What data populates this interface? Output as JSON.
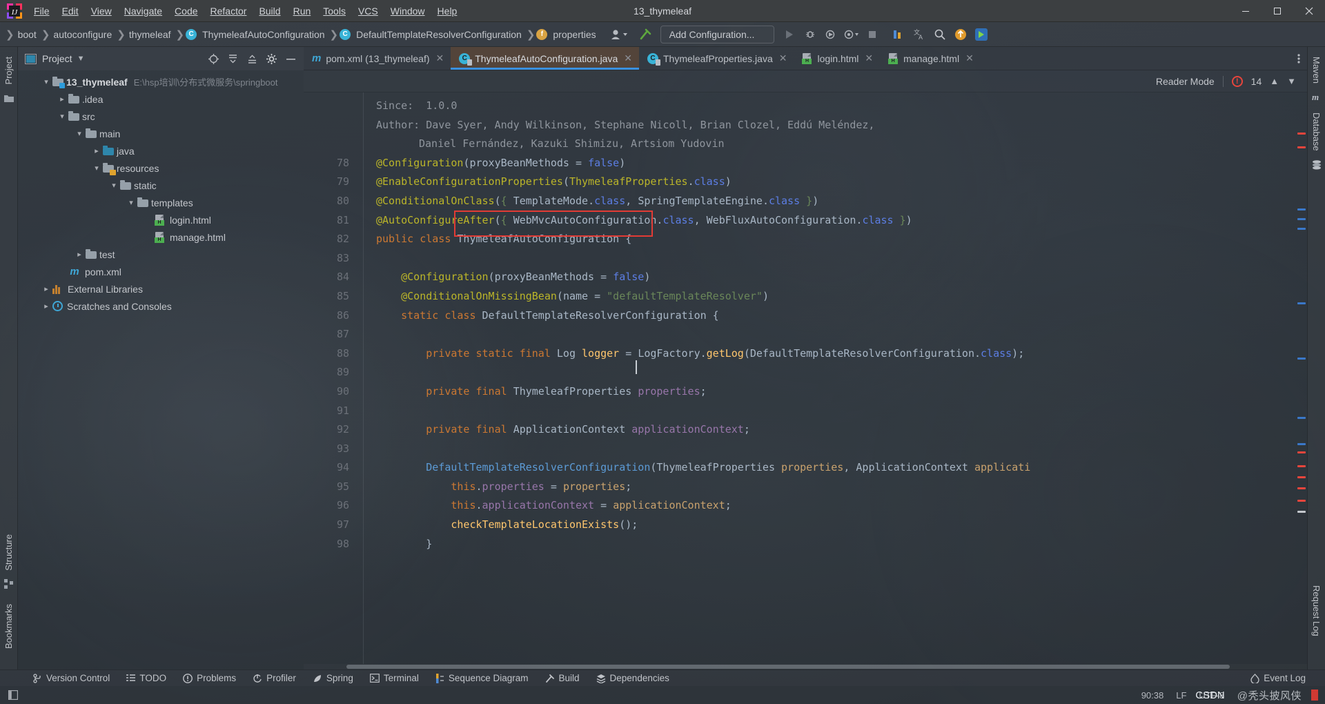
{
  "window": {
    "title": "13_thymeleaf",
    "controls": {
      "minimize": "minimize-icon",
      "maximize": "maximize-icon",
      "close": "close-icon"
    }
  },
  "menu": [
    {
      "label": "File",
      "mnemonic": "F"
    },
    {
      "label": "Edit",
      "mnemonic": "E"
    },
    {
      "label": "View",
      "mnemonic": "V"
    },
    {
      "label": "Navigate",
      "mnemonic": "N"
    },
    {
      "label": "Code",
      "mnemonic": "C"
    },
    {
      "label": "Refactor",
      "mnemonic": "R"
    },
    {
      "label": "Build",
      "mnemonic": "B"
    },
    {
      "label": "Run",
      "mnemonic": "u"
    },
    {
      "label": "Tools",
      "mnemonic": "T"
    },
    {
      "label": "VCS",
      "mnemonic": ""
    },
    {
      "label": "Window",
      "mnemonic": "W"
    },
    {
      "label": "Help",
      "mnemonic": "H"
    }
  ],
  "breadcrumb": [
    {
      "label": "boot",
      "icon": ""
    },
    {
      "label": "autoconfigure",
      "icon": ""
    },
    {
      "label": "thymeleaf",
      "icon": ""
    },
    {
      "label": "ThymeleafAutoConfiguration",
      "icon": "class-icon",
      "badge": "C"
    },
    {
      "label": "DefaultTemplateResolverConfiguration",
      "icon": "class-icon",
      "badge": "C"
    },
    {
      "label": "properties",
      "icon": "field-icon",
      "badge": "f"
    }
  ],
  "toolbar": {
    "add_configuration": "Add Configuration...",
    "buttons": [
      "user-icon",
      "hammer-build-icon",
      "run-icon",
      "debug-icon",
      "run-with-coverage-icon",
      "profile-icon",
      "stop-icon",
      "search-everywhere-icon",
      "translate-icon",
      "update-icon",
      "ide-icon"
    ]
  },
  "left_stripe": [
    {
      "label": "Project",
      "name": "tool-window-project"
    },
    {
      "label": "Structure",
      "name": "tool-window-structure"
    },
    {
      "label": "Bookmarks",
      "name": "tool-window-bookmarks"
    }
  ],
  "right_stripe": [
    {
      "label": "Maven",
      "name": "tool-window-maven"
    },
    {
      "label": "Database",
      "name": "tool-window-database"
    },
    {
      "label": "Request Log",
      "name": "tool-window-request-log"
    }
  ],
  "project": {
    "title": "Project",
    "actions": [
      "locate-icon",
      "expand-all-icon",
      "collapse-all-icon",
      "settings-icon",
      "hide-icon"
    ],
    "tree": [
      {
        "label": "13_thymeleaf",
        "path": "E:\\hsp培训\\分布式微服务\\springboot",
        "indent": 0,
        "arrow": "down",
        "icon": "module-folder",
        "bold": true
      },
      {
        "label": ".idea",
        "path": "",
        "indent": 1,
        "arrow": "right",
        "icon": "folder"
      },
      {
        "label": "src",
        "path": "",
        "indent": 1,
        "arrow": "down",
        "icon": "folder"
      },
      {
        "label": "main",
        "path": "",
        "indent": 2,
        "arrow": "down",
        "icon": "folder"
      },
      {
        "label": "java",
        "path": "",
        "indent": 3,
        "arrow": "right",
        "icon": "source-folder"
      },
      {
        "label": "resources",
        "path": "",
        "indent": 3,
        "arrow": "down",
        "icon": "resources-folder"
      },
      {
        "label": "static",
        "path": "",
        "indent": 4,
        "arrow": "down",
        "icon": "folder"
      },
      {
        "label": "templates",
        "path": "",
        "indent": 5,
        "arrow": "down",
        "icon": "folder"
      },
      {
        "label": "login.html",
        "path": "",
        "indent": 6,
        "arrow": "none",
        "icon": "html-file"
      },
      {
        "label": "manage.html",
        "path": "",
        "indent": 6,
        "arrow": "none",
        "icon": "html-file"
      },
      {
        "label": "test",
        "path": "",
        "indent": 2,
        "arrow": "right",
        "icon": "folder"
      },
      {
        "label": "pom.xml",
        "path": "",
        "indent": 1,
        "arrow": "none",
        "icon": "maven-file"
      },
      {
        "label": "External Libraries",
        "path": "",
        "indent": 0,
        "arrow": "right",
        "icon": "library-icon"
      },
      {
        "label": "Scratches and Consoles",
        "path": "",
        "indent": 0,
        "arrow": "right",
        "icon": "scratches-icon"
      }
    ]
  },
  "editor": {
    "tabs": [
      {
        "label": "pom.xml (13_thymeleaf)",
        "icon": "maven-icon",
        "active": false
      },
      {
        "label": "ThymeleafAutoConfiguration.java",
        "icon": "java-class-icon",
        "active": true
      },
      {
        "label": "ThymeleafProperties.java",
        "icon": "java-class-icon",
        "active": false
      },
      {
        "label": "login.html",
        "icon": "html-icon",
        "active": false
      },
      {
        "label": "manage.html",
        "icon": "html-icon",
        "active": false
      }
    ],
    "more_tabs": "more-tabs-icon",
    "reader_mode": "Reader Mode",
    "problem_count": "14",
    "doc_header": [
      "Since:  1.0.0",
      "Author: Dave Syer, Andy Wilkinson, Stephane Nicoll, Brian Clozel, Eddú Meléndez,",
      "Daniel Fernández, Kazuki Shimizu, Artsiom Yudovin"
    ],
    "first_line_number": 78,
    "lines": [
      {
        "n": "78",
        "fold": "minus",
        "text": "@Configuration(proxyBeanMethods = false)"
      },
      {
        "n": "79",
        "fold": "",
        "text": "@EnableConfigurationProperties(ThymeleafProperties.class)"
      },
      {
        "n": "80",
        "fold": "",
        "text": "@ConditionalOnClass({ TemplateMode.class, SpringTemplateEngine.class })"
      },
      {
        "n": "81",
        "fold": "minus",
        "text": "@AutoConfigureAfter({ WebMvcAutoConfiguration.class, WebFluxAutoConfiguration.class })"
      },
      {
        "n": "82",
        "fold": "",
        "text": "public class ThymeleafAutoConfiguration {"
      },
      {
        "n": "83",
        "fold": "",
        "text": ""
      },
      {
        "n": "84",
        "fold": "minus",
        "text": "    @Configuration(proxyBeanMethods = false)"
      },
      {
        "n": "85",
        "fold": "minus",
        "text": "    @ConditionalOnMissingBean(name = \"defaultTemplateResolver\")"
      },
      {
        "n": "86",
        "fold": "minus",
        "text": "    static class DefaultTemplateResolverConfiguration {"
      },
      {
        "n": "87",
        "fold": "",
        "text": ""
      },
      {
        "n": "88",
        "fold": "",
        "text": "        private static final Log logger = LogFactory.getLog(DefaultTemplateResolverConfiguration.class);"
      },
      {
        "n": "89",
        "fold": "",
        "text": ""
      },
      {
        "n": "90",
        "fold": "",
        "text": "        private final ThymeleafProperties properties;"
      },
      {
        "n": "91",
        "fold": "",
        "text": ""
      },
      {
        "n": "92",
        "fold": "",
        "text": "        private final ApplicationContext applicationContext;"
      },
      {
        "n": "93",
        "fold": "",
        "text": ""
      },
      {
        "n": "94",
        "fold": "minus",
        "text": "        DefaultTemplateResolverConfiguration(ThymeleafProperties properties, ApplicationContext applicati"
      },
      {
        "n": "95",
        "fold": "",
        "text": "            this.properties = properties;"
      },
      {
        "n": "96",
        "fold": "",
        "text": "            this.applicationContext = applicationContext;"
      },
      {
        "n": "97",
        "fold": "",
        "text": "            checkTemplateLocationExists();"
      },
      {
        "n": "98",
        "fold": "",
        "text": "        }"
      }
    ],
    "highlight_box_text": "ThymeleafAutoConfiguration {"
  },
  "bottom_tools": [
    {
      "label": "Version Control",
      "icon": "branch-icon"
    },
    {
      "label": "TODO",
      "icon": "list-icon"
    },
    {
      "label": "Problems",
      "icon": "error-icon"
    },
    {
      "label": "Profiler",
      "icon": "profiler-icon"
    },
    {
      "label": "Spring",
      "icon": "spring-leaf-icon"
    },
    {
      "label": "Terminal",
      "icon": "terminal-icon"
    },
    {
      "label": "Sequence Diagram",
      "icon": "sequence-diagram-icon"
    },
    {
      "label": "Build",
      "icon": "build-hammer-icon"
    },
    {
      "label": "Dependencies",
      "icon": "dependencies-icon"
    }
  ],
  "event_log": {
    "label": "Event Log",
    "icon": "event-log-icon"
  },
  "status": {
    "caret": "90:38",
    "line_separator": "LF",
    "encoding": "UTF-8",
    "watermark_csdn": "CSDN",
    "watermark_author": "@秃头披风侠"
  },
  "colors": {
    "accent_blue": "#3a91e0",
    "annotation": "#bbb529",
    "keyword": "#cc7832",
    "string": "#6a8759",
    "field": "#9876aa",
    "number": "#6897bb",
    "method": "#ffc66d",
    "error_red": "#e8453c",
    "tab_active_bg": "#6e4d34"
  }
}
